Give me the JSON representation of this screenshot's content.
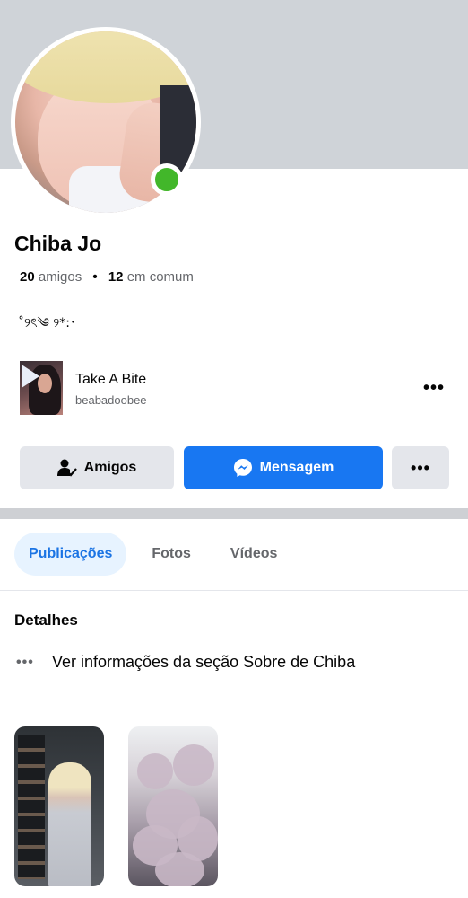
{
  "profile": {
    "name": "Chiba Jo",
    "friends_count": "20",
    "friends_label": "amigos",
    "separator": "•",
    "mutual_count": "12",
    "mutual_label": "em comum",
    "bio": "˚୨ৎ༄ ୨*:･",
    "online": true
  },
  "song": {
    "title": "Take A Bite",
    "artist": "beabadoobee",
    "more": "•••"
  },
  "actions": {
    "friends_label": "Amigos",
    "message_label": "Mensagem",
    "more_label": "•••"
  },
  "tabs": [
    {
      "label": "Publicações",
      "active": true
    },
    {
      "label": "Fotos",
      "active": false
    },
    {
      "label": "Vídeos",
      "active": false
    }
  ],
  "details": {
    "title": "Detalhes",
    "dots": "•••",
    "about_link": "Ver informações da seção Sobre de Chiba"
  },
  "colors": {
    "accent": "#1877f2",
    "online": "#42b72a",
    "tab_active_bg": "#e7f3ff",
    "tab_active_text": "#1b74e4",
    "button_gray": "#e4e6eb",
    "cover": "#cfd3d8"
  },
  "icons": {
    "friends_button": "person-check-icon",
    "message_button": "messenger-icon",
    "song_play": "play-icon"
  }
}
